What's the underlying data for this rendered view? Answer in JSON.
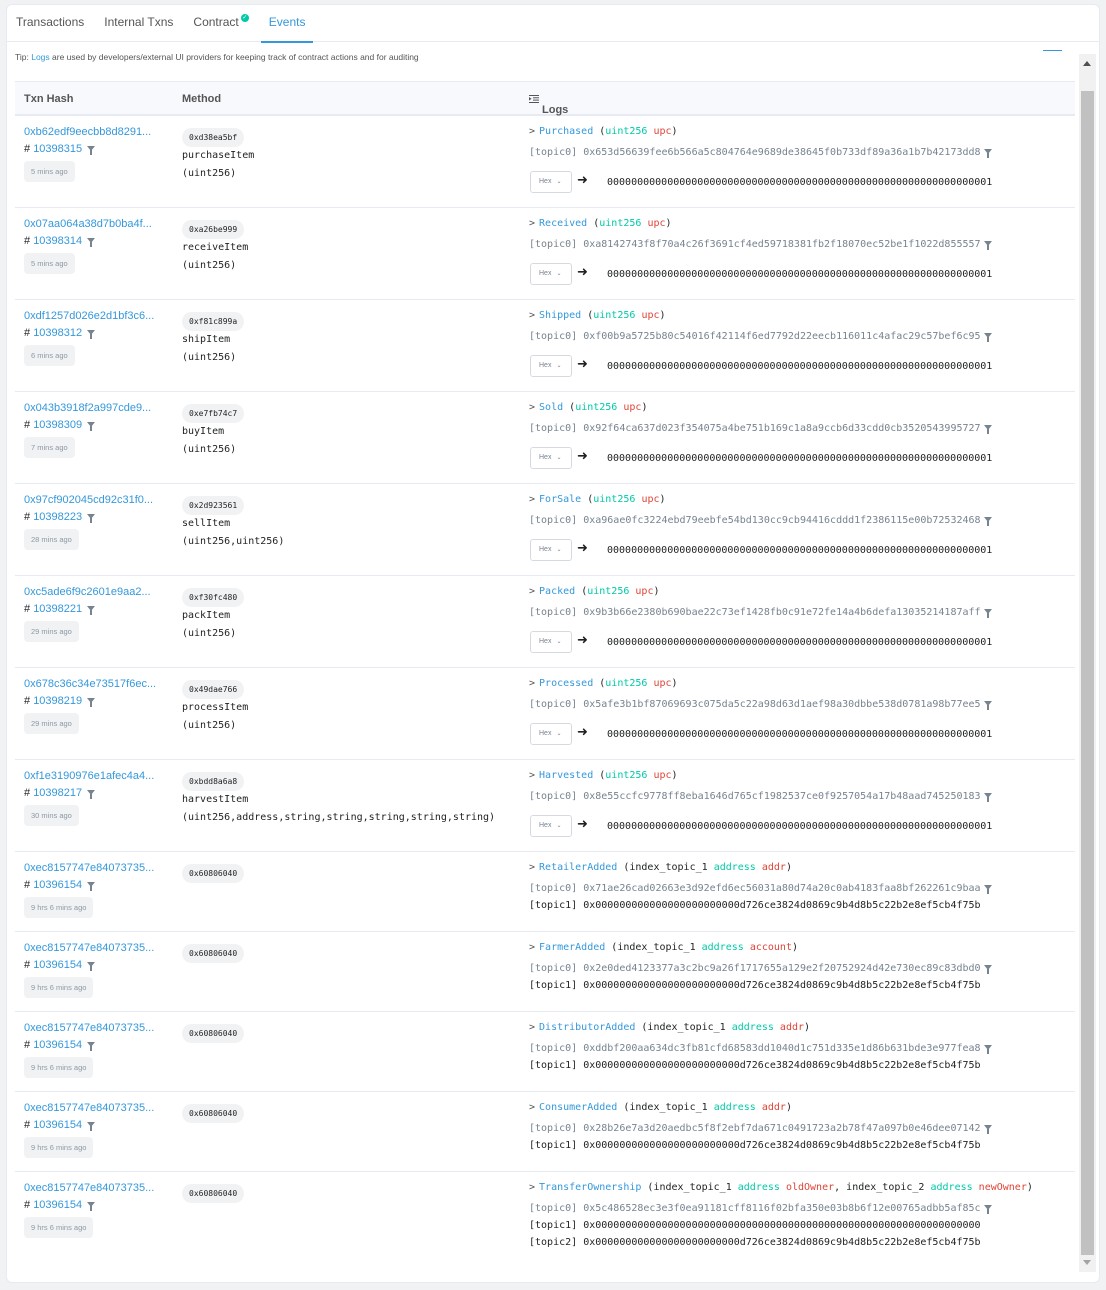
{
  "tabs": [
    {
      "label": "Transactions",
      "active": false
    },
    {
      "label": "Internal Txns",
      "active": false
    },
    {
      "label": "Contract",
      "active": false,
      "verified": true
    },
    {
      "label": "Events",
      "active": true
    }
  ],
  "tip": {
    "prefix": "Tip: ",
    "link": "Logs",
    "suffix": " are used by developers/external UI providers for keeping track of contract actions and for auditing"
  },
  "table": {
    "headers": {
      "txn_hash": "Txn Hash",
      "method": "Method",
      "logs": "Logs"
    },
    "hex_label": "Hex",
    "rows": [
      {
        "txn_hash": "0xb62edf9eecbb8d8291...",
        "block": "10398315",
        "age": "5 mins ago",
        "selector": "0xd38ea5bf",
        "method_name": "purchaseItem",
        "method_args": "(uint256)",
        "event": "Purchased",
        "params": [
          {
            "type": "uint256",
            "name": "upc"
          }
        ],
        "topics": [
          {
            "label": "[topic0]",
            "value": "0x653d56639fee6b566a5c804764e9689de38645f0b733df89a36a1b7b42173dd8"
          }
        ],
        "data": "0000000000000000000000000000000000000000000000000000000000000001"
      },
      {
        "txn_hash": "0x07aa064a38d7b0ba4f...",
        "block": "10398314",
        "age": "5 mins ago",
        "selector": "0xa26be999",
        "method_name": "receiveItem",
        "method_args": "(uint256)",
        "event": "Received",
        "params": [
          {
            "type": "uint256",
            "name": "upc"
          }
        ],
        "topics": [
          {
            "label": "[topic0]",
            "value": "0xa8142743f8f70a4c26f3691cf4ed59718381fb2f18070ec52be1f1022d855557"
          }
        ],
        "data": "0000000000000000000000000000000000000000000000000000000000000001"
      },
      {
        "txn_hash": "0xdf1257d026e2d1bf3c6...",
        "block": "10398312",
        "age": "6 mins ago",
        "selector": "0xf81c899a",
        "method_name": "shipItem",
        "method_args": "(uint256)",
        "event": "Shipped",
        "params": [
          {
            "type": "uint256",
            "name": "upc"
          }
        ],
        "topics": [
          {
            "label": "[topic0]",
            "value": "0xf00b9a5725b80c54016f42114f6ed7792d22eecb116011c4afac29c57bef6c95"
          }
        ],
        "data": "0000000000000000000000000000000000000000000000000000000000000001"
      },
      {
        "txn_hash": "0x043b3918f2a997cde9...",
        "block": "10398309",
        "age": "7 mins ago",
        "selector": "0xe7fb74c7",
        "method_name": "buyItem",
        "method_args": "(uint256)",
        "event": "Sold",
        "params": [
          {
            "type": "uint256",
            "name": "upc"
          }
        ],
        "topics": [
          {
            "label": "[topic0]",
            "value": "0x92f64ca637d023f354075a4be751b169c1a8a9ccb6d33cdd0cb3520543995727"
          }
        ],
        "data": "0000000000000000000000000000000000000000000000000000000000000001"
      },
      {
        "txn_hash": "0x97cf902045cd92c31f0...",
        "block": "10398223",
        "age": "28 mins ago",
        "selector": "0x2d923561",
        "method_name": "sellItem",
        "method_args": "(uint256,uint256)",
        "event": "ForSale",
        "params": [
          {
            "type": "uint256",
            "name": "upc"
          }
        ],
        "topics": [
          {
            "label": "[topic0]",
            "value": "0xa96ae0fc3224ebd79eebfe54bd130cc9cb94416cddd1f2386115e00b72532468"
          }
        ],
        "data": "0000000000000000000000000000000000000000000000000000000000000001"
      },
      {
        "txn_hash": "0xc5ade6f9c2601e9aa2...",
        "block": "10398221",
        "age": "29 mins ago",
        "selector": "0xf30fc480",
        "method_name": "packItem",
        "method_args": "(uint256)",
        "event": "Packed",
        "params": [
          {
            "type": "uint256",
            "name": "upc"
          }
        ],
        "topics": [
          {
            "label": "[topic0]",
            "value": "0x9b3b66e2380b690bae22c73ef1428fb0c91e72fe14a4b6defa13035214187aff"
          }
        ],
        "data": "0000000000000000000000000000000000000000000000000000000000000001"
      },
      {
        "txn_hash": "0x678c36c34e73517f6ec...",
        "block": "10398219",
        "age": "29 mins ago",
        "selector": "0x49dae766",
        "method_name": "processItem",
        "method_args": "(uint256)",
        "event": "Processed",
        "params": [
          {
            "type": "uint256",
            "name": "upc"
          }
        ],
        "topics": [
          {
            "label": "[topic0]",
            "value": "0x5afe3b1bf87069693c075da5c22a98d63d1aef98a30dbbe538d0781a98b77ee5"
          }
        ],
        "data": "0000000000000000000000000000000000000000000000000000000000000001"
      },
      {
        "txn_hash": "0xf1e3190976e1afec4a4...",
        "block": "10398217",
        "age": "30 mins ago",
        "selector": "0xbdd8a6a8",
        "method_name": "harvestItem",
        "method_args": "(uint256,address,string,string,string,string,string)",
        "event": "Harvested",
        "params": [
          {
            "type": "uint256",
            "name": "upc"
          }
        ],
        "topics": [
          {
            "label": "[topic0]",
            "value": "0x8e55ccfc9778ff8eba1646d765cf1982537ce0f9257054a17b48aad745250183"
          }
        ],
        "data": "0000000000000000000000000000000000000000000000000000000000000001"
      },
      {
        "txn_hash": "0xec8157747e84073735...",
        "block": "10396154",
        "age": "9 hrs 6 mins ago",
        "selector": "0x60806040",
        "method_name": "",
        "method_args": "",
        "event": "RetailerAdded",
        "params": [
          {
            "prefix": "index_topic_1",
            "type": "address",
            "name": "addr"
          }
        ],
        "topics": [
          {
            "label": "[topic0]",
            "value": "0x71ae26cad02663e3d92efd6ec56031a80d74a20c0ab4183faa8bf262261c9baa"
          },
          {
            "label": "[topic1]",
            "value": "0x000000000000000000000000d726ce3824d0869c9b4d8b5c22b2e8ef5cb4f75b"
          }
        ],
        "data": ""
      },
      {
        "txn_hash": "0xec8157747e84073735...",
        "block": "10396154",
        "age": "9 hrs 6 mins ago",
        "selector": "0x60806040",
        "method_name": "",
        "method_args": "",
        "event": "FarmerAdded",
        "params": [
          {
            "prefix": "index_topic_1",
            "type": "address",
            "name": "account"
          }
        ],
        "topics": [
          {
            "label": "[topic0]",
            "value": "0x2e0ded4123377a3c2bc9a26f1717655a129e2f20752924d42e730ec89c83dbd0"
          },
          {
            "label": "[topic1]",
            "value": "0x000000000000000000000000d726ce3824d0869c9b4d8b5c22b2e8ef5cb4f75b"
          }
        ],
        "data": ""
      },
      {
        "txn_hash": "0xec8157747e84073735...",
        "block": "10396154",
        "age": "9 hrs 6 mins ago",
        "selector": "0x60806040",
        "method_name": "",
        "method_args": "",
        "event": "DistributorAdded",
        "params": [
          {
            "prefix": "index_topic_1",
            "type": "address",
            "name": "addr"
          }
        ],
        "topics": [
          {
            "label": "[topic0]",
            "value": "0xddbf200aa634dc3fb81cfd68583dd1040d1c751d335e1d86b631bde3e977fea8"
          },
          {
            "label": "[topic1]",
            "value": "0x000000000000000000000000d726ce3824d0869c9b4d8b5c22b2e8ef5cb4f75b"
          }
        ],
        "data": ""
      },
      {
        "txn_hash": "0xec8157747e84073735...",
        "block": "10396154",
        "age": "9 hrs 6 mins ago",
        "selector": "0x60806040",
        "method_name": "",
        "method_args": "",
        "event": "ConsumerAdded",
        "params": [
          {
            "prefix": "index_topic_1",
            "type": "address",
            "name": "addr"
          }
        ],
        "topics": [
          {
            "label": "[topic0]",
            "value": "0x28b26e7a3d20aedbc5f8f2ebf7da671c0491723a2b78f47a097b0e46dee07142"
          },
          {
            "label": "[topic1]",
            "value": "0x000000000000000000000000d726ce3824d0869c9b4d8b5c22b2e8ef5cb4f75b"
          }
        ],
        "data": ""
      },
      {
        "txn_hash": "0xec8157747e84073735...",
        "block": "10396154",
        "age": "9 hrs 6 mins ago",
        "selector": "0x60806040",
        "method_name": "",
        "method_args": "",
        "event": "TransferOwnership",
        "params": [
          {
            "prefix": "index_topic_1",
            "type": "address",
            "name": "oldOwner"
          },
          {
            "prefix": "index_topic_2",
            "type": "address",
            "name": "newOwner"
          }
        ],
        "topics": [
          {
            "label": "[topic0]",
            "value": "0x5c486528ec3e3f0ea91181cff8116f02bfa350e03b8b6f12e00765adbb5af85c"
          },
          {
            "label": "[topic1]",
            "value": "0x0000000000000000000000000000000000000000000000000000000000000000"
          },
          {
            "label": "[topic2]",
            "value": "0x000000000000000000000000d726ce3824d0869c9b4d8b5c22b2e8ef5cb4f75b"
          }
        ],
        "data": ""
      }
    ]
  },
  "colors": {
    "accent": "#3498db",
    "type": "#00c9a7",
    "param": "#de4437",
    "verified": "#00c9a7"
  }
}
